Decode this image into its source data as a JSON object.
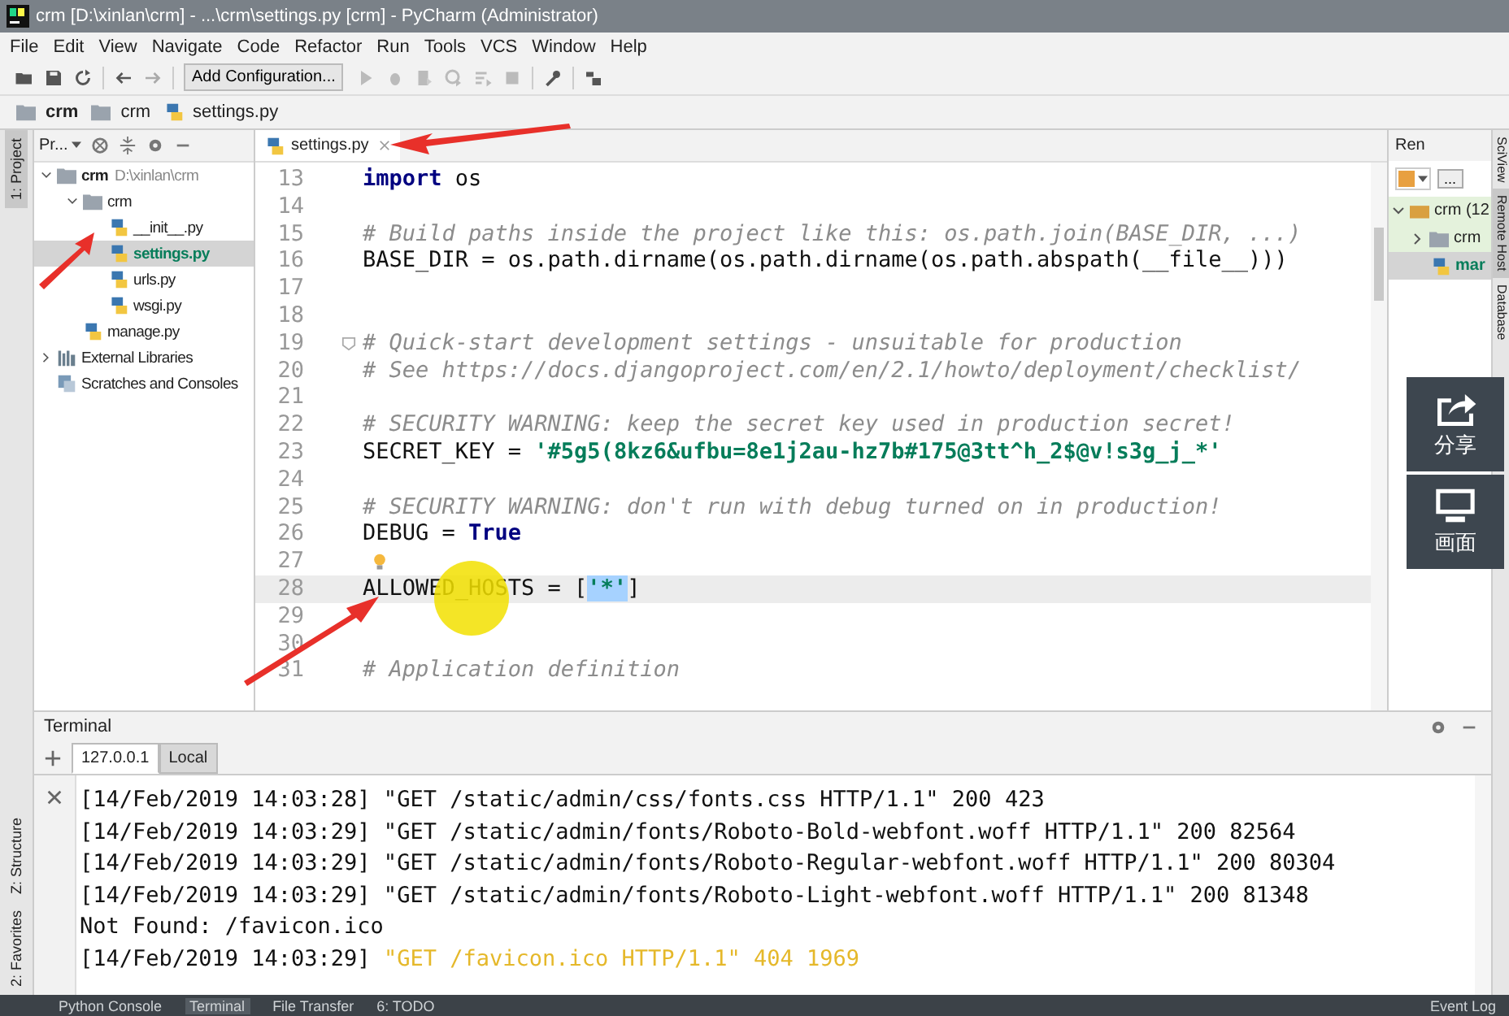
{
  "window": {
    "title": "crm [D:\\xinlan\\crm] - ...\\crm\\settings.py [crm] - PyCharm (Administrator)"
  },
  "menu": [
    {
      "label": "File"
    },
    {
      "label": "Edit"
    },
    {
      "label": "View"
    },
    {
      "label": "Navigate"
    },
    {
      "label": "Code"
    },
    {
      "label": "Refactor"
    },
    {
      "label": "Run"
    },
    {
      "label": "Tools"
    },
    {
      "label": "VCS"
    },
    {
      "label": "Window"
    },
    {
      "label": "Help"
    }
  ],
  "toolbar": {
    "run_configuration": "Add Configuration..."
  },
  "breadcrumbs": [
    {
      "label": "crm",
      "kind": "folder",
      "bold": true
    },
    {
      "label": "crm",
      "kind": "folder",
      "bold": false
    },
    {
      "label": "settings.py",
      "kind": "file",
      "bold": false
    }
  ],
  "left_stripe": {
    "top": "1: Project",
    "bottom": [
      "Z: Structure",
      "2: Favorites"
    ]
  },
  "project_panel": {
    "title": "Pr...",
    "tree": [
      {
        "label": "crm",
        "path": "D:\\xinlan\\crm",
        "kind": "folder",
        "expanded": true,
        "selected": false,
        "children": [
          {
            "label": "crm",
            "kind": "folder",
            "expanded": true,
            "selected": false,
            "children": [
              {
                "label": "__init__.py",
                "kind": "file",
                "selected": false
              },
              {
                "label": "settings.py",
                "kind": "file",
                "selected": true
              },
              {
                "label": "urls.py",
                "kind": "file",
                "selected": false
              },
              {
                "label": "wsgi.py",
                "kind": "file",
                "selected": false
              }
            ]
          },
          {
            "label": "manage.py",
            "kind": "file",
            "selected": false
          }
        ]
      },
      {
        "label": "External Libraries",
        "kind": "library",
        "expanded": false,
        "selected": false
      },
      {
        "label": "Scratches and Consoles",
        "kind": "scratches",
        "selected": false
      }
    ]
  },
  "editor": {
    "tabs": [
      {
        "label": "settings.py",
        "selected": true
      }
    ],
    "lines": [
      {
        "number": "13",
        "current": false,
        "segments": [
          {
            "text": "import",
            "kind": "keyword"
          },
          {
            "text": " os",
            "kind": "plain"
          }
        ]
      },
      {
        "number": "14",
        "current": false
      },
      {
        "number": "15",
        "current": false,
        "segments": [
          {
            "text": "# Build paths inside the project like this: os.path.join(BASE_DIR, ...)",
            "kind": "comment"
          }
        ]
      },
      {
        "number": "16",
        "current": false,
        "segments": [
          {
            "text": "BASE_DIR = os.path.dirname(os.path.dirname(os.path.abspath(__file__)))",
            "kind": "plain"
          }
        ]
      },
      {
        "number": "17",
        "current": false
      },
      {
        "number": "18",
        "current": false
      },
      {
        "number": "19",
        "current": false,
        "kind": "fold",
        "segments": [
          {
            "text": "# Quick-start development settings - unsuitable for production",
            "kind": "comment"
          }
        ]
      },
      {
        "number": "20",
        "current": false,
        "segments": [
          {
            "text": "# See https://docs.djangoproject.com/en/2.1/howto/deployment/checklist/",
            "kind": "comment"
          }
        ]
      },
      {
        "number": "21",
        "current": false
      },
      {
        "number": "22",
        "current": false,
        "segments": [
          {
            "text": "# SECURITY WARNING: keep the secret key used in production secret!",
            "kind": "comment"
          }
        ]
      },
      {
        "number": "23",
        "current": false,
        "segments": [
          {
            "text": "SECRET_KEY = ",
            "kind": "plain"
          },
          {
            "text": "'#5g5(8kz6&ufbu=8e1j2au-hz7b#175@3tt^h_2$@v!s3g_j_*'",
            "kind": "string"
          }
        ]
      },
      {
        "number": "24",
        "current": false
      },
      {
        "number": "25",
        "current": false,
        "segments": [
          {
            "text": "# SECURITY WARNING: don't run with debug turned on in production!",
            "kind": "comment"
          }
        ]
      },
      {
        "number": "26",
        "current": false,
        "segments": [
          {
            "text": "DEBUG = ",
            "kind": "plain"
          },
          {
            "text": "True",
            "kind": "keyword"
          }
        ]
      },
      {
        "number": "27",
        "current": false,
        "kind": "bulb"
      },
      {
        "number": "28",
        "current": true,
        "segments": [
          {
            "text": "ALLOWED_HOSTS = [",
            "kind": "plain"
          },
          {
            "text": "'*'",
            "kind": "selected"
          },
          {
            "text": "]",
            "kind": "plain"
          }
        ]
      },
      {
        "number": "29",
        "current": false
      },
      {
        "number": "30",
        "current": false
      },
      {
        "number": "31",
        "current": false,
        "segments": [
          {
            "text": "# Application definition",
            "kind": "comment"
          }
        ]
      }
    ]
  },
  "remote_panel": {
    "title": "Ren",
    "more_button": "...",
    "tree": [
      {
        "label": "crm (12",
        "kind": "server",
        "expanded": true,
        "selected": false
      },
      {
        "label": "crm",
        "kind": "folder",
        "expanded": false,
        "selected": false
      },
      {
        "label": "mar",
        "kind": "file",
        "selected": true
      }
    ]
  },
  "right_stripe": [
    {
      "label": "SciView",
      "selected": false
    },
    {
      "label": "Remote Host",
      "selected": true
    },
    {
      "label": "Database",
      "selected": false
    }
  ],
  "share_widget": [
    {
      "label": "分享",
      "kind": "share"
    },
    {
      "label": "画面",
      "kind": "screen"
    }
  ],
  "terminal": {
    "title": "Terminal",
    "tabs": [
      {
        "label": "127.0.0.1",
        "selected": true
      },
      {
        "label": "Local",
        "selected": false
      }
    ],
    "lines": [
      [
        {
          "text": "[14/Feb/2019 14:03:28] \"GET /static/admin/css/fonts.css HTTP/1.1\" 200 423",
          "kind": "plain"
        }
      ],
      [
        {
          "text": "[14/Feb/2019 14:03:29] \"GET /static/admin/fonts/Roboto-Bold-webfont.woff HTTP/1.1\" 200 82564",
          "kind": "plain"
        }
      ],
      [
        {
          "text": "[14/Feb/2019 14:03:29] \"GET /static/admin/fonts/Roboto-Regular-webfont.woff HTTP/1.1\" 200 80304",
          "kind": "plain"
        }
      ],
      [
        {
          "text": "[14/Feb/2019 14:03:29] \"GET /static/admin/fonts/Roboto-Light-webfont.woff HTTP/1.1\" 200 81348",
          "kind": "plain"
        }
      ],
      [
        {
          "text": "Not Found: /favicon.ico",
          "kind": "plain"
        }
      ],
      [
        {
          "text": "[14/Feb/2019 14:03:29] ",
          "kind": "plain"
        },
        {
          "text": "\"GET /favicon.ico HTTP/1.1\" 404 1969",
          "kind": "warning"
        }
      ]
    ]
  },
  "status_bar": {
    "tools": [
      {
        "label": "Python Console",
        "selected": false
      },
      {
        "label": "Terminal",
        "selected": true
      },
      {
        "label": "File Transfer",
        "selected": false
      },
      {
        "label": "6: TODO",
        "selected": false
      }
    ],
    "event_log": "Event Log"
  }
}
